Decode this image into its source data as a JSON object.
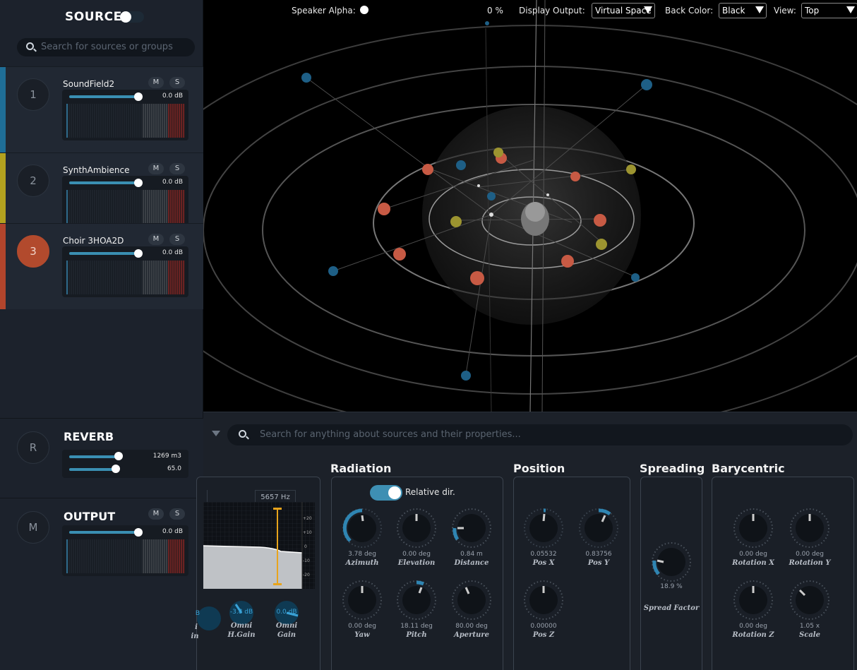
{
  "topbar": {
    "speaker_alpha_label": "Speaker Alpha:",
    "alpha_percent": "0 %",
    "display_output_label": "Display Output:",
    "display_output_value": "Virtual Space",
    "back_color_label": "Back Color:",
    "back_color_value": "Black",
    "view_label": "View:",
    "view_value": "Top"
  },
  "sidebar": {
    "title": "SOURCES",
    "search_placeholder": "Search for sources or groups",
    "tracks": [
      {
        "num": "1",
        "name": "SoundField2",
        "m": "M",
        "s": "S",
        "db": "0.0 dB",
        "color": "#1f6e97"
      },
      {
        "num": "2",
        "name": "SynthAmbience",
        "m": "M",
        "s": "S",
        "db": "0.0 dB",
        "color": "#b3a21f"
      },
      {
        "num": "3",
        "name": "Choir 3HOA2D",
        "m": "M",
        "s": "S",
        "db": "0.0 dB",
        "color": "#b2452c"
      }
    ],
    "reverb": {
      "num": "R",
      "title": "REVERB",
      "volume": "1269 m3",
      "value2": "65.0"
    },
    "output": {
      "num": "M",
      "title": "OUTPUT",
      "m": "M",
      "s": "S",
      "db": "0.0 dB"
    }
  },
  "panel": {
    "search_placeholder": "Search for anything about sources and their properties...",
    "eq_freq": "5657 Hz",
    "eq_scale": [
      "+20",
      "+10",
      "0",
      "-10",
      "-20"
    ],
    "omni_knobs": [
      {
        "value": "B",
        "label1": "i",
        "label2": "in"
      },
      {
        "value": "-3.8 dB",
        "label1": "Omni",
        "label2": "H.Gain"
      },
      {
        "value": "0.0 dB",
        "label1": "Omni",
        "label2": "Gain"
      }
    ],
    "sections": {
      "radiation": "Radiation",
      "position": "Position",
      "spreading": "Spreading",
      "barycentric": "Barycentric"
    },
    "relative_dir_label": "Relative dir.",
    "radiation_knobs": [
      {
        "value": "3.78 deg",
        "label": "Azimuth"
      },
      {
        "value": "0.00 deg",
        "label": "Elevation"
      },
      {
        "value": "0.84 m",
        "label": "Distance"
      },
      {
        "value": "0.00 deg",
        "label": "Yaw"
      },
      {
        "value": "18.11 deg",
        "label": "Pitch"
      },
      {
        "value": "80.00 deg",
        "label": "Aperture"
      }
    ],
    "position_knobs": [
      {
        "value": "0.05532",
        "label": "Pos X"
      },
      {
        "value": "0.83756",
        "label": "Pos Y"
      },
      {
        "value": "0.00000",
        "label": "Pos Z"
      }
    ],
    "spreading_knob": {
      "value": "18.9 %",
      "label": "Spread Factor"
    },
    "barycentric_knobs": [
      {
        "value": "0.00 deg",
        "label": "Rotation X"
      },
      {
        "value": "0.00 deg",
        "label": "Rotation Y"
      },
      {
        "value": "0.00 deg",
        "label": "Rotation Z"
      },
      {
        "value": "1.05 x",
        "label": "Scale"
      }
    ]
  }
}
